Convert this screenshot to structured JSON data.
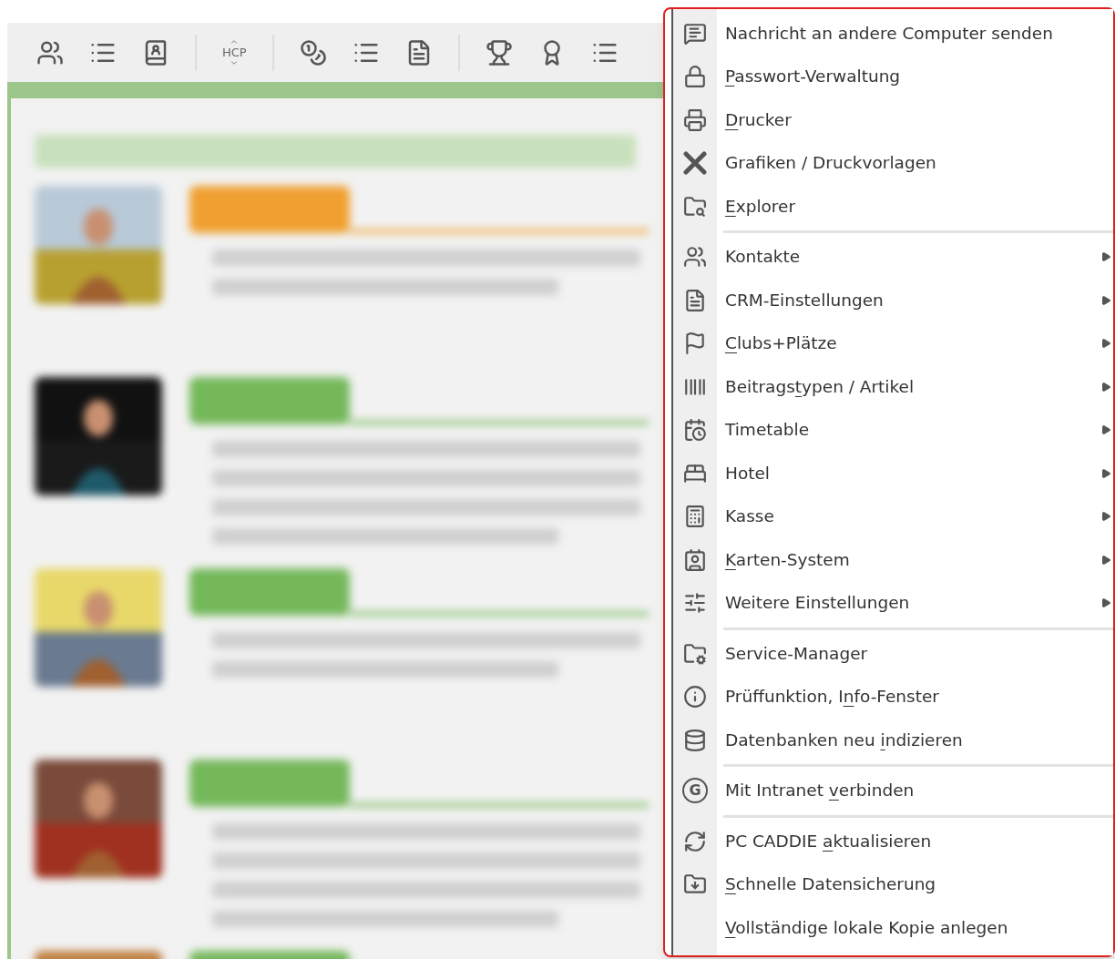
{
  "toolbar": {
    "hcp_label": "HCP"
  },
  "news": {
    "cards": [
      {
        "color": "#f0a030"
      },
      {
        "color": "#74b85a"
      },
      {
        "color": "#74b85a"
      },
      {
        "color": "#74b85a"
      },
      {
        "color": "#74b85a"
      }
    ]
  },
  "context_menu": {
    "entries": [
      {
        "kind": "item",
        "label": "Nachricht an andere Computer senden",
        "submenu": false
      },
      {
        "kind": "item",
        "key": "P",
        "post": "asswort-Verwaltung",
        "submenu": false
      },
      {
        "kind": "item",
        "key": "D",
        "post": "rucker",
        "submenu": false
      },
      {
        "kind": "item",
        "label": "Grafiken / Druckvorlagen",
        "submenu": false
      },
      {
        "kind": "item",
        "key": "E",
        "post": "xplorer",
        "submenu": false
      },
      {
        "kind": "separator"
      },
      {
        "kind": "item",
        "label": "Kontakte",
        "submenu": true
      },
      {
        "kind": "item",
        "label": "CRM-Einstellungen",
        "submenu": true
      },
      {
        "kind": "item",
        "key": "C",
        "post": "lubs+Plätze",
        "submenu": true
      },
      {
        "kind": "item",
        "pre": "Beitrags",
        "key": "t",
        "post": "ypen / Artikel",
        "submenu": true
      },
      {
        "kind": "item",
        "label": "Timetable",
        "submenu": true
      },
      {
        "kind": "item",
        "label": "Hotel",
        "submenu": true
      },
      {
        "kind": "item",
        "label": "Kasse",
        "submenu": true
      },
      {
        "kind": "item",
        "key": "K",
        "post": "arten-System",
        "submenu": true
      },
      {
        "kind": "item",
        "label": "Weitere Einstellungen",
        "submenu": true
      },
      {
        "kind": "separator"
      },
      {
        "kind": "item",
        "label": "Service-Manager",
        "submenu": false
      },
      {
        "kind": "item",
        "pre": "Prüffunktion, I",
        "key": "n",
        "post": "fo-Fenster",
        "submenu": false
      },
      {
        "kind": "item",
        "pre": "Datenbanken neu ",
        "key": "i",
        "post": "ndizieren",
        "submenu": false
      },
      {
        "kind": "separator"
      },
      {
        "kind": "item",
        "pre": "Mit Intranet ",
        "key": "v",
        "post": "erbinden",
        "submenu": false,
        "icon_glyph": "G"
      },
      {
        "kind": "separator"
      },
      {
        "kind": "item",
        "pre": "PC CADDIE ",
        "key": "a",
        "post": "ktualisieren",
        "submenu": false
      },
      {
        "kind": "item",
        "key": "S",
        "post": "chnelle Datensicherung",
        "submenu": false
      },
      {
        "kind": "item",
        "key": "V",
        "post": "ollständige lokale Kopie anlegen",
        "submenu": false
      }
    ]
  }
}
